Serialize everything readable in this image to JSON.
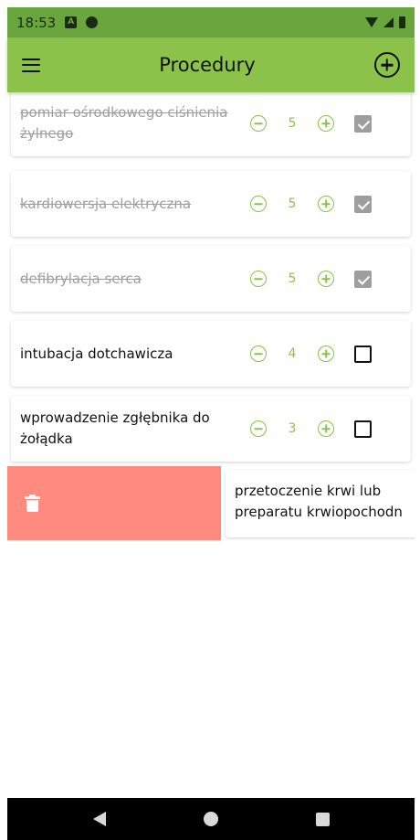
{
  "status_bar": {
    "time": "18:53",
    "notification_icons": [
      "a-notification-icon",
      "g-notification-icon"
    ],
    "system_icons": [
      "wifi-icon",
      "signal-icon",
      "battery-icon"
    ]
  },
  "app_bar": {
    "title": "Procedury",
    "menu_icon": "menu-icon",
    "add_icon": "add-circle-icon",
    "background": "#8bc34a"
  },
  "procedures": [
    {
      "label": "pomiar ośrodkowego ciśnienia żylnego",
      "count": "5",
      "done": true
    },
    {
      "label": "kardiowersja elektryczna",
      "count": "5",
      "done": true
    },
    {
      "label": "defibrylacja serca",
      "count": "5",
      "done": true
    },
    {
      "label": "intubacja dotchawicza",
      "count": "4",
      "done": false
    },
    {
      "label": "wprowadzenie zgłębnika do żołądka",
      "count": "3",
      "done": false
    }
  ],
  "swiped_item": {
    "label_line1": "przetoczenie krwi lub",
    "label_line2": "preparatu krwiopochodn",
    "delete_icon": "delete-icon",
    "delete_background": "#ff8a80"
  },
  "nav_bar": {
    "buttons": [
      "back-icon",
      "home-icon",
      "recents-icon"
    ]
  },
  "colors": {
    "accent": "#8bc34a",
    "status_bar": "#6aa63d",
    "done_text": "#9e9e9e"
  }
}
